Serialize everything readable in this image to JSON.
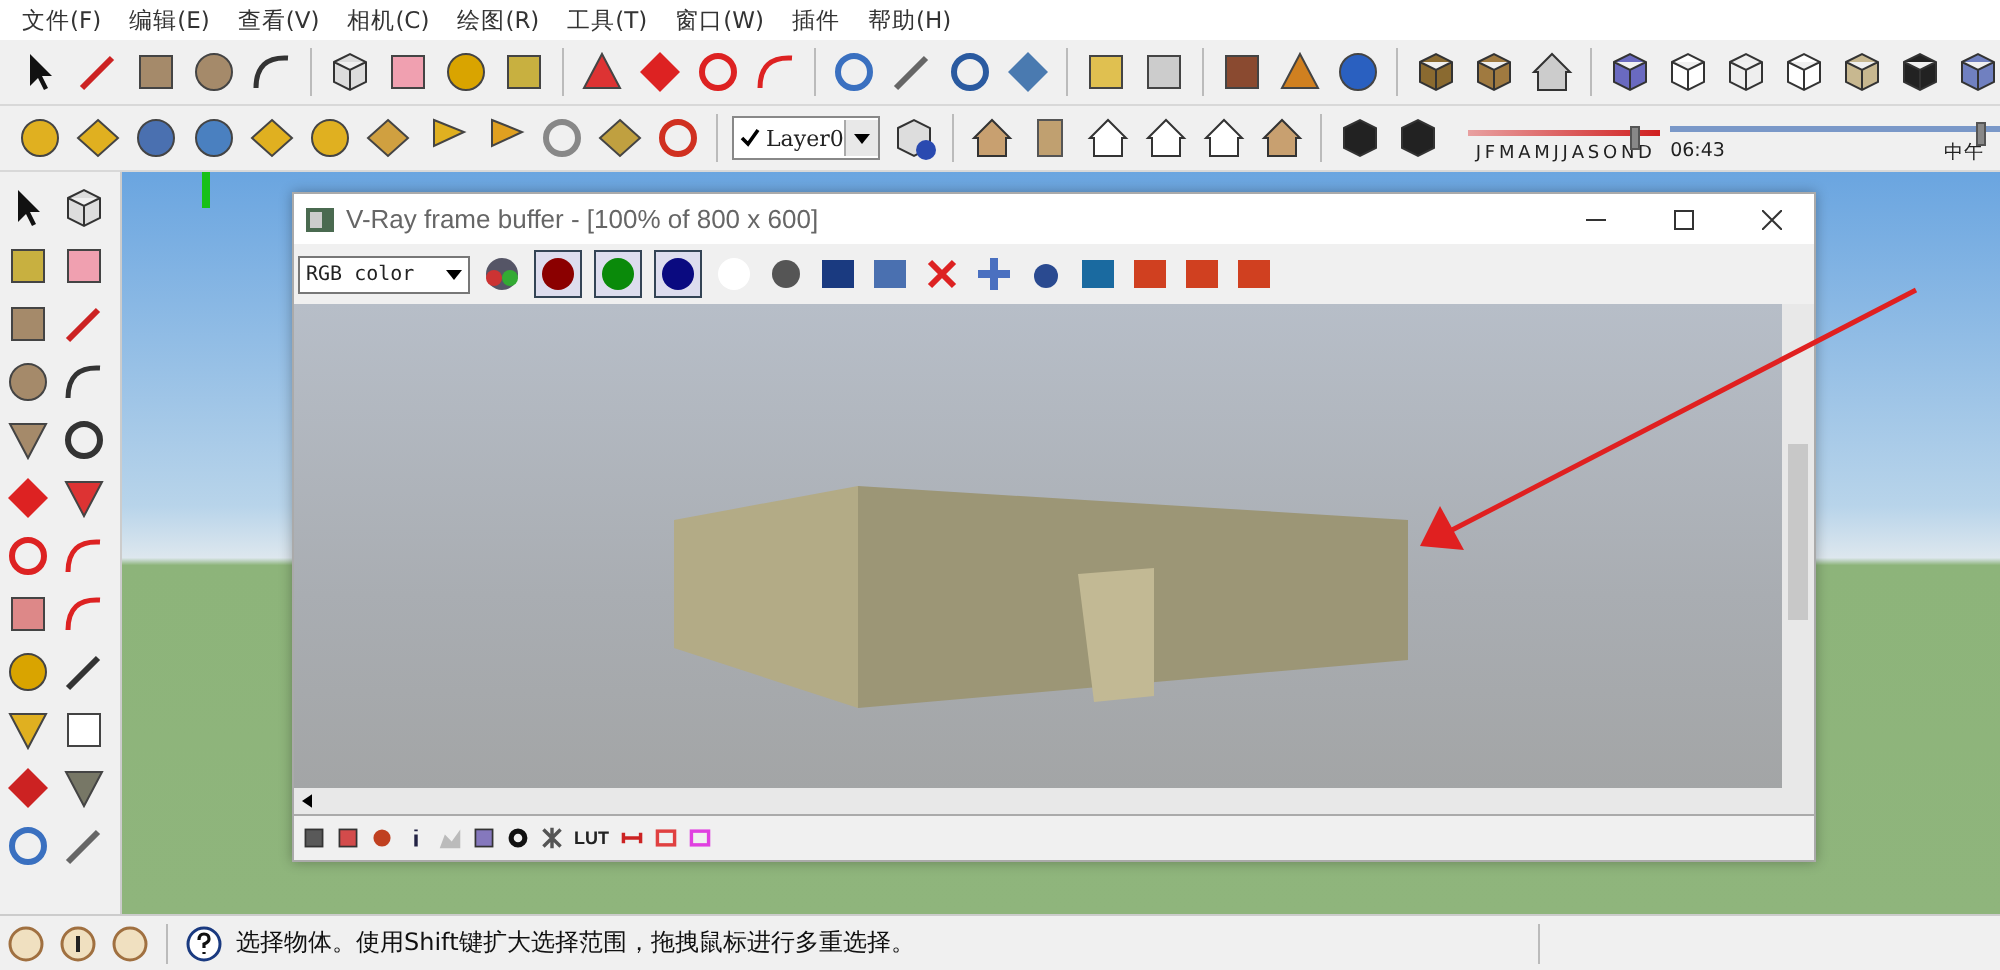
{
  "menu": [
    "文件(F)",
    "编辑(E)",
    "查看(V)",
    "相机(C)",
    "绘图(R)",
    "工具(T)",
    "窗口(W)",
    "插件",
    "帮助(H)"
  ],
  "layer": {
    "name": "Layer0",
    "checked": true
  },
  "shadow": {
    "months": [
      "J",
      "F",
      "M",
      "A",
      "M",
      "J",
      "J",
      "A",
      "S",
      "O",
      "N",
      "D"
    ],
    "date_slider": {
      "level": 0.84
    },
    "time": "06:43",
    "noon": "中午",
    "time_slider": {
      "level": 0.93
    }
  },
  "vray": {
    "title": "V-Ray frame buffer - [100% of 800 x 600]",
    "channel": "RGB color",
    "channels": [
      {
        "color": "#8b0000",
        "selected": true
      },
      {
        "color": "#0a8a0a",
        "selected": true
      },
      {
        "color": "#0a0a80",
        "selected": true
      }
    ],
    "lut": "LUT"
  },
  "status": {
    "text": "选择物体。使用Shift键扩大选择范围，拖拽鼠标进行多重选择。"
  }
}
